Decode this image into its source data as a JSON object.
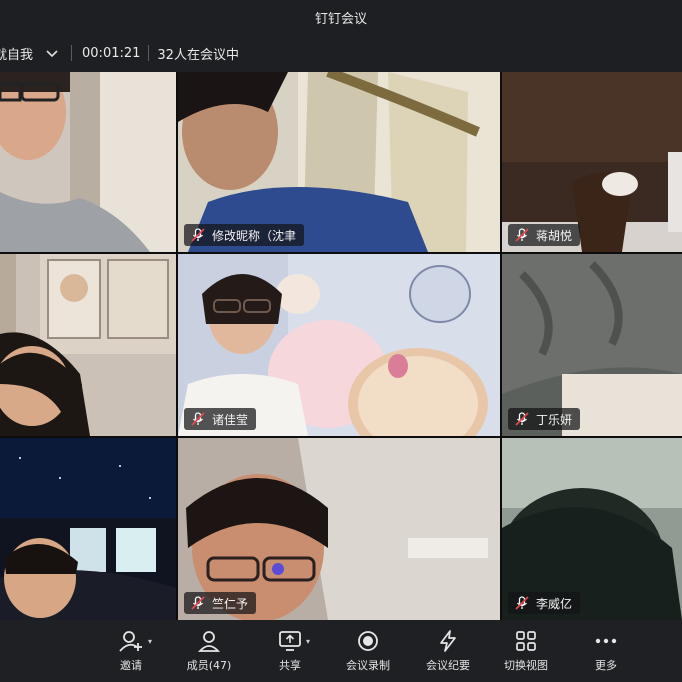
{
  "window": {
    "title": "钉钉会议"
  },
  "meeting": {
    "host_name": "就自我",
    "elapsed": "00:01:21",
    "participants_text": "32人在会议中"
  },
  "tiles": [
    {
      "name": ""
    },
    {
      "name": "修改昵称（沈聿"
    },
    {
      "name": "蒋胡悦"
    },
    {
      "name": ""
    },
    {
      "name": "诸佳莹"
    },
    {
      "name": "丁乐妍"
    },
    {
      "name": ""
    },
    {
      "name": "竺仁予"
    },
    {
      "name": "李威亿"
    }
  ],
  "toolbar": {
    "invite": "邀请",
    "members": "成员(47)",
    "share": "共享",
    "record": "会议录制",
    "minutes": "会议纪要",
    "switch_view": "切换视图",
    "more": "更多"
  },
  "colors": {
    "background": "#1b1c1f",
    "toolbar": "#1f2023",
    "muted_mic": "#e5484d"
  }
}
